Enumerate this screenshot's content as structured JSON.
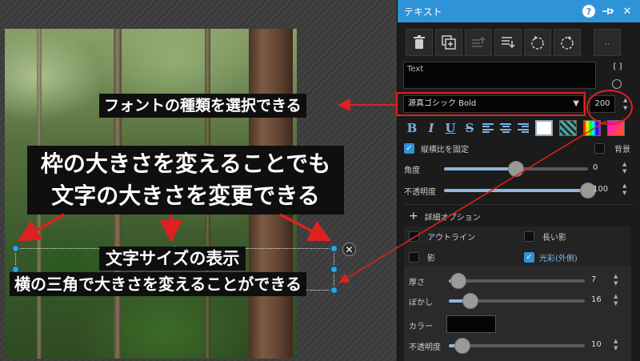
{
  "colors": {
    "accent": "#2f93d8",
    "annotation_red": "#e02020",
    "panel_bg": "#1b1b1b"
  },
  "annotations": {
    "font_select": "フォントの種類を選択できる",
    "frame_line1": "枠の大きさを変えることでも",
    "frame_line2": "文字の大きさを変更できる",
    "size_display": "文字サイズの表示",
    "triangle_resize": "横の三角で大きさを変えることができる"
  },
  "panel": {
    "title": "テキスト",
    "title_icons": [
      "help-icon",
      "pin-icon",
      "close-icon"
    ],
    "toolbar_icons": [
      "trash-icon",
      "duplicate-icon",
      "bring-front-icon",
      "send-back-icon",
      "rotate-left-icon",
      "rotate-right-icon",
      "more-icon"
    ],
    "more_label": "..",
    "text_value": "Text",
    "bracket_label": "[ ]",
    "font_name": "源真ゴシック Bold",
    "font_size": "200",
    "keep_ratio_label": "縦横比を固定",
    "background_label": "背景",
    "angle_label": "角度",
    "angle_value": "0",
    "opacity_label": "不透明度",
    "opacity_value": "100",
    "detail_label": "詳細オプション",
    "outline_label": "アウトライン",
    "long_shadow_label": "長い影",
    "shadow_label": "影",
    "glow_label": "光彩(外側)",
    "thickness_label": "厚さ",
    "thickness_value": "7",
    "blur_label": "ぼかし",
    "blur_value": "16",
    "color_label": "カラー",
    "glow_opacity_label": "不透明度",
    "glow_opacity_value": "10"
  },
  "sliders": {
    "angle": 0.5,
    "opacity": 1.0,
    "thickness": 0.07,
    "blur": 0.16,
    "glow_opacity": 0.1
  },
  "checkboxes": {
    "keep_ratio": true,
    "background": false,
    "outline": false,
    "long_shadow": false,
    "shadow": false,
    "glow": true
  }
}
